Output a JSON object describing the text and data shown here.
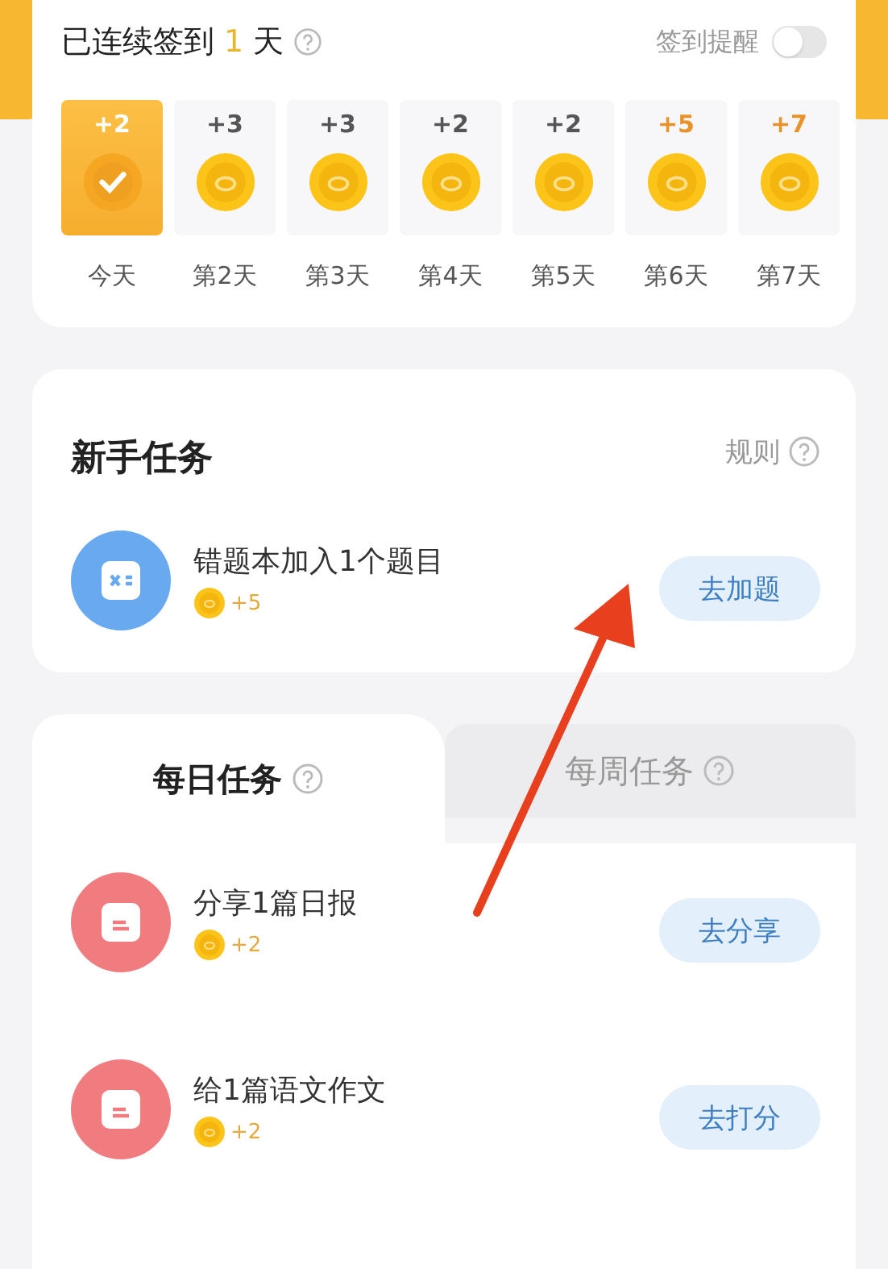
{
  "checkin": {
    "prefix": "已连续签到",
    "count": "1",
    "suffix": "天",
    "reminder_label": "签到提醒",
    "reminder_on": false,
    "days": [
      {
        "points": "+2",
        "label": "今天",
        "checked": true,
        "bonus": false
      },
      {
        "points": "+3",
        "label": "第2天",
        "checked": false,
        "bonus": false
      },
      {
        "points": "+3",
        "label": "第3天",
        "checked": false,
        "bonus": false
      },
      {
        "points": "+2",
        "label": "第4天",
        "checked": false,
        "bonus": false
      },
      {
        "points": "+2",
        "label": "第5天",
        "checked": false,
        "bonus": false
      },
      {
        "points": "+5",
        "label": "第6天",
        "checked": false,
        "bonus": true
      },
      {
        "points": "+7",
        "label": "第7天",
        "checked": false,
        "bonus": true
      }
    ]
  },
  "newbie": {
    "title": "新手任务",
    "rules": "规则",
    "tasks": [
      {
        "kind": "blue",
        "title": "错题本加入1个题目",
        "reward": "+5",
        "action": "去加题"
      }
    ]
  },
  "tabs": [
    {
      "label": "每日任务",
      "selected": true
    },
    {
      "label": "每周任务",
      "selected": false
    }
  ],
  "daily_tasks": [
    {
      "kind": "red",
      "title": "分享1篇日报",
      "reward": "+2",
      "action": "去分享"
    },
    {
      "kind": "red",
      "title": "给1篇语文作文",
      "reward": "+2",
      "action": "去打分"
    }
  ]
}
